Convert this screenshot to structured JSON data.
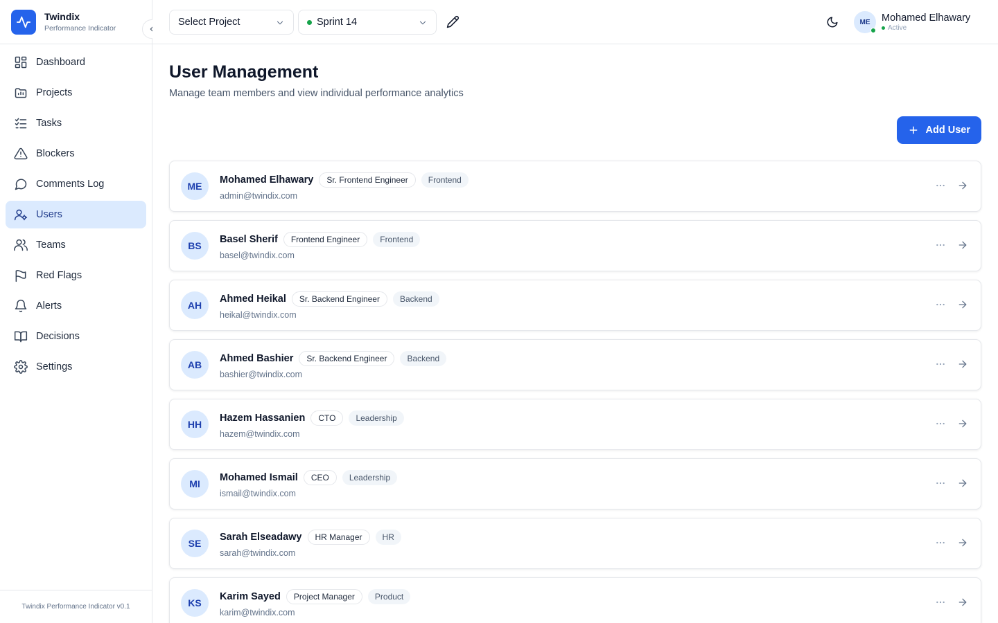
{
  "brand": {
    "name": "Twindix",
    "subtitle": "Performance Indicator"
  },
  "sidebar": {
    "items": [
      {
        "label": "Dashboard",
        "icon": "dashboard-icon"
      },
      {
        "label": "Projects",
        "icon": "projects-icon"
      },
      {
        "label": "Tasks",
        "icon": "tasks-icon"
      },
      {
        "label": "Blockers",
        "icon": "warning-icon"
      },
      {
        "label": "Comments Log",
        "icon": "comment-icon"
      },
      {
        "label": "Users",
        "icon": "users-icon",
        "active": true
      },
      {
        "label": "Teams",
        "icon": "teams-icon"
      },
      {
        "label": "Red Flags",
        "icon": "flag-icon"
      },
      {
        "label": "Alerts",
        "icon": "bell-icon"
      },
      {
        "label": "Decisions",
        "icon": "book-icon"
      },
      {
        "label": "Settings",
        "icon": "gear-icon"
      }
    ],
    "footer": "Twindix Performance Indicator v0.1"
  },
  "topbar": {
    "project_select": "Select Project",
    "sprint_select": "Sprint 14",
    "user": {
      "initials": "ME",
      "name": "Mohamed Elhawary",
      "status": "Active"
    }
  },
  "page": {
    "title": "User Management",
    "subtitle": "Manage team members and view individual performance analytics",
    "add_button": "Add User"
  },
  "users": [
    {
      "initials": "ME",
      "name": "Mohamed Elhawary",
      "role": "Sr. Frontend Engineer",
      "dept": "Frontend",
      "email": "admin@twindix.com"
    },
    {
      "initials": "BS",
      "name": "Basel Sherif",
      "role": "Frontend Engineer",
      "dept": "Frontend",
      "email": "basel@twindix.com"
    },
    {
      "initials": "AH",
      "name": "Ahmed Heikal",
      "role": "Sr. Backend Engineer",
      "dept": "Backend",
      "email": "heikal@twindix.com"
    },
    {
      "initials": "AB",
      "name": "Ahmed Bashier",
      "role": "Sr. Backend Engineer",
      "dept": "Backend",
      "email": "bashier@twindix.com"
    },
    {
      "initials": "HH",
      "name": "Hazem Hassanien",
      "role": "CTO",
      "dept": "Leadership",
      "email": "hazem@twindix.com"
    },
    {
      "initials": "MI",
      "name": "Mohamed Ismail",
      "role": "CEO",
      "dept": "Leadership",
      "email": "ismail@twindix.com"
    },
    {
      "initials": "SE",
      "name": "Sarah Elseadawy",
      "role": "HR Manager",
      "dept": "HR",
      "email": "sarah@twindix.com"
    },
    {
      "initials": "KS",
      "name": "Karim Sayed",
      "role": "Project Manager",
      "dept": "Product",
      "email": "karim@twindix.com"
    }
  ],
  "colors": {
    "accent": "#2563eb",
    "active_nav_bg": "#dbeafe",
    "status_green": "#16a34a"
  }
}
